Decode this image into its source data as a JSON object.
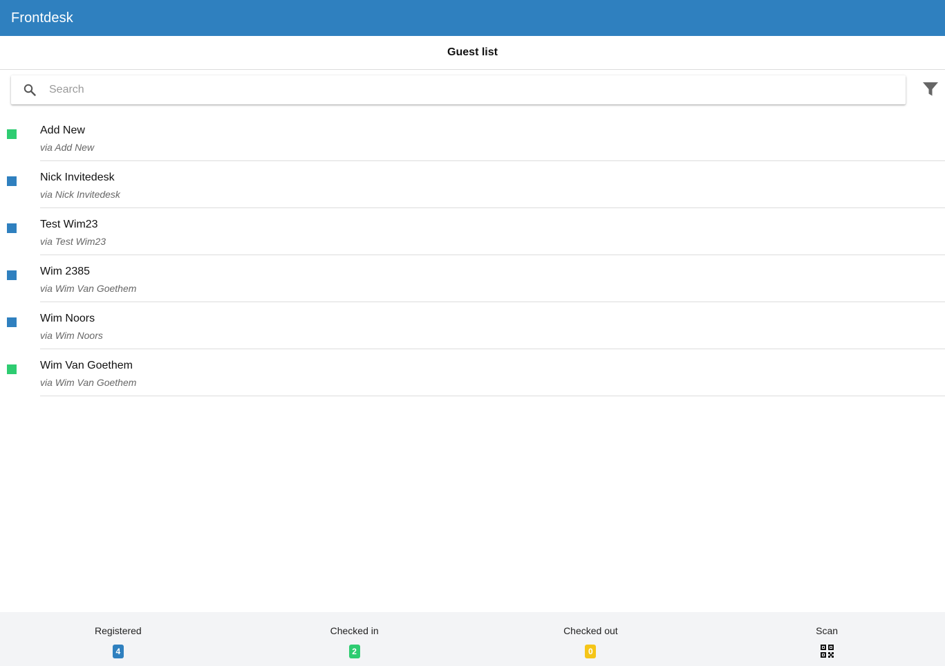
{
  "header": {
    "app_title": "Frontdesk"
  },
  "subheader": {
    "page_title": "Guest list"
  },
  "search": {
    "placeholder": "Search",
    "value": ""
  },
  "colors": {
    "brand": "#2f80bf",
    "status_registered": "#2f80bf",
    "status_checked_in": "#2ecc71",
    "status_checked_out": "#f5c518"
  },
  "guests": [
    {
      "name": "Add New",
      "via": "via Add New",
      "status": "checked_in",
      "status_color": "#2ecc71"
    },
    {
      "name": "Nick Invitedesk",
      "via": "via Nick Invitedesk",
      "status": "registered",
      "status_color": "#2f80bf"
    },
    {
      "name": "Test Wim23",
      "via": "via Test Wim23",
      "status": "registered",
      "status_color": "#2f80bf"
    },
    {
      "name": "Wim 2385",
      "via": "via Wim Van Goethem",
      "status": "registered",
      "status_color": "#2f80bf"
    },
    {
      "name": "Wim Noors",
      "via": "via Wim Noors",
      "status": "registered",
      "status_color": "#2f80bf"
    },
    {
      "name": "Wim Van Goethem",
      "via": "via Wim Van Goethem",
      "status": "checked_in",
      "status_color": "#2ecc71"
    }
  ],
  "bottom_nav": {
    "registered": {
      "label": "Registered",
      "count": "4",
      "color": "#2f80bf"
    },
    "checked_in": {
      "label": "Checked in",
      "count": "2",
      "color": "#2ecc71"
    },
    "checked_out": {
      "label": "Checked out",
      "count": "0",
      "color": "#f5c518"
    },
    "scan": {
      "label": "Scan",
      "icon": "qr-code-icon"
    }
  }
}
